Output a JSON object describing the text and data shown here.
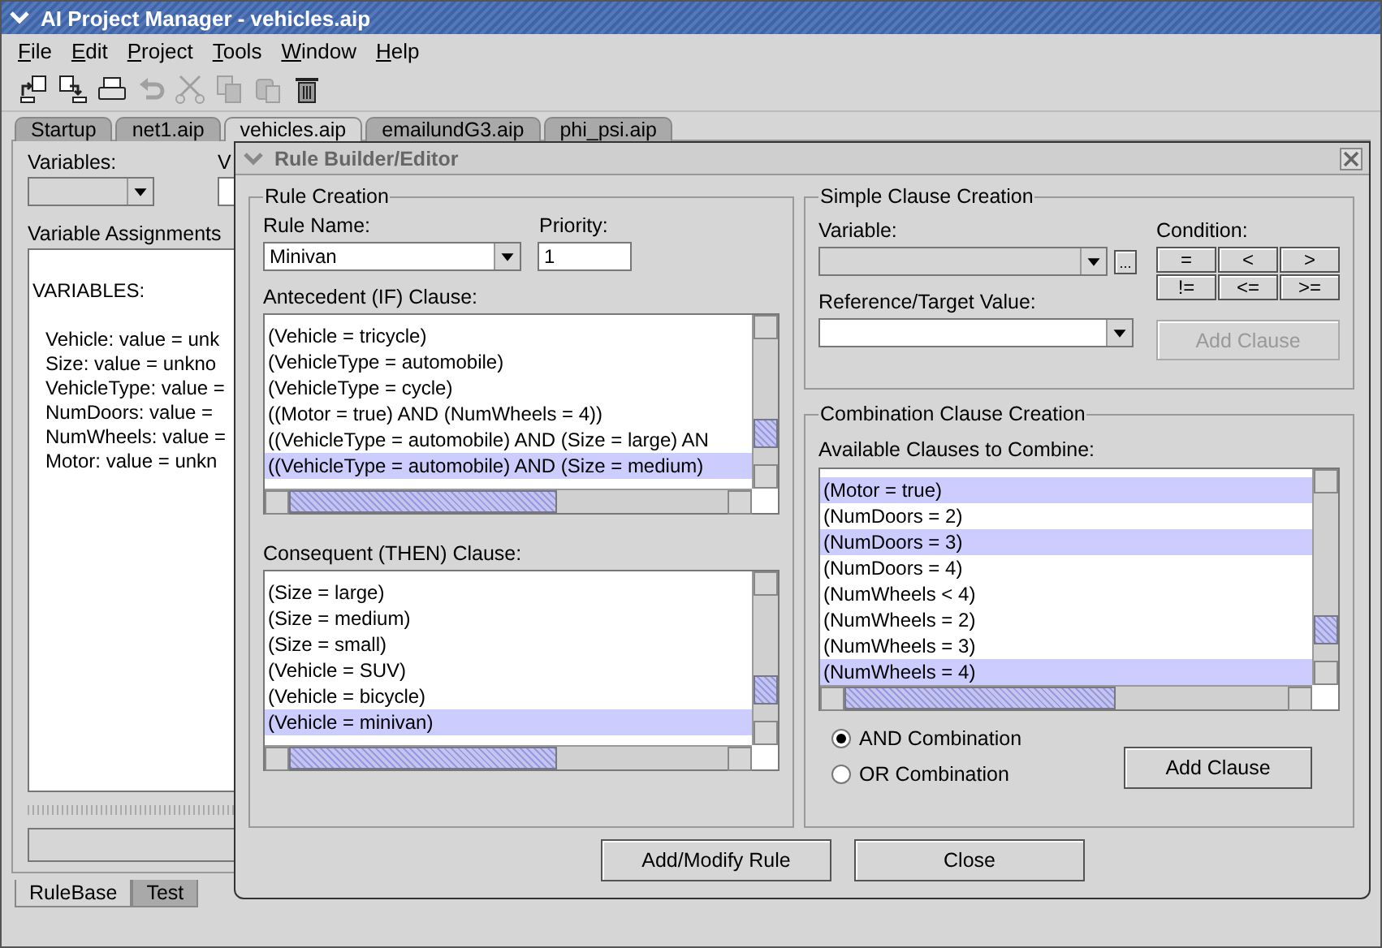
{
  "window": {
    "title": "AI Project Manager - vehicles.aip"
  },
  "menu": [
    "File",
    "Edit",
    "Project",
    "Tools",
    "Window",
    "Help"
  ],
  "toolbar": [
    {
      "kind": "open",
      "disabled": false
    },
    {
      "kind": "save",
      "disabled": false
    },
    {
      "kind": "print",
      "disabled": false
    },
    {
      "kind": "undo",
      "disabled": true
    },
    {
      "kind": "cut",
      "disabled": true
    },
    {
      "kind": "copy",
      "disabled": true
    },
    {
      "kind": "paste",
      "disabled": true
    },
    {
      "kind": "delete",
      "disabled": false
    }
  ],
  "tabs": [
    {
      "label": "Startup",
      "selected": false
    },
    {
      "label": "net1.aip",
      "selected": false
    },
    {
      "label": "vehicles.aip",
      "selected": true
    },
    {
      "label": "emailundG3.aip",
      "selected": false
    },
    {
      "label": "phi_psi.aip",
      "selected": false
    }
  ],
  "main_panel": {
    "variables_label": "Variables:",
    "value_label": "V",
    "assignments_label": "Variable Assignments",
    "assignments_heading": "VARIABLES:",
    "assignments_lines": [
      "Vehicle: value = unk",
      "Size: value = unkno",
      "VehicleType: value =",
      "NumDoors: value =",
      "NumWheels: value =",
      "Motor: value = unkn"
    ]
  },
  "bottom_tabs": [
    {
      "label": "RuleBase",
      "selected": true
    },
    {
      "label": "Test",
      "selected": false
    }
  ],
  "dialog": {
    "title": "Rule Builder/Editor",
    "rule_creation": {
      "legend": "Rule Creation",
      "rule_name_label": "Rule Name:",
      "rule_name": "Minivan",
      "priority_label": "Priority:",
      "priority": "1",
      "antecedent_label": "Antecedent (IF) Clause:",
      "antecedent_items": [
        {
          "text": "(Vehicle = tricycle)",
          "selected": false
        },
        {
          "text": "(VehicleType = automobile)",
          "selected": false
        },
        {
          "text": "(VehicleType = cycle)",
          "selected": false
        },
        {
          "text": "((Motor = true) AND (NumWheels = 4))",
          "selected": false
        },
        {
          "text": "((VehicleType = automobile) AND (Size = large) AN",
          "selected": false
        },
        {
          "text": "((VehicleType = automobile) AND (Size = medium)",
          "selected": true
        }
      ],
      "consequent_label": "Consequent (THEN) Clause:",
      "consequent_items": [
        {
          "text": "(Size = large)",
          "selected": false
        },
        {
          "text": "(Size = medium)",
          "selected": false
        },
        {
          "text": "(Size = small)",
          "selected": false
        },
        {
          "text": "(Vehicle = SUV)",
          "selected": false
        },
        {
          "text": "(Vehicle = bicycle)",
          "selected": false
        },
        {
          "text": "(Vehicle = minivan)",
          "selected": true
        }
      ]
    },
    "simple_clause": {
      "legend": "Simple Clause Creation",
      "variable_label": "Variable:",
      "more_button": "...",
      "condition_label": "Condition:",
      "conditions": [
        "=",
        "<",
        ">",
        "!=",
        "<=",
        ">="
      ],
      "target_label": "Reference/Target Value:",
      "add_button": {
        "label": "Add Clause",
        "disabled": true
      }
    },
    "combination": {
      "legend": "Combination Clause Creation",
      "available_label": "Available Clauses to Combine:",
      "items": [
        {
          "text": "(Motor = true)",
          "selected": true
        },
        {
          "text": "(NumDoors = 2)",
          "selected": false
        },
        {
          "text": "(NumDoors = 3)",
          "selected": true
        },
        {
          "text": "(NumDoors = 4)",
          "selected": false
        },
        {
          "text": "(NumWheels < 4)",
          "selected": false
        },
        {
          "text": "(NumWheels = 2)",
          "selected": false
        },
        {
          "text": "(NumWheels = 3)",
          "selected": false
        },
        {
          "text": "(NumWheels = 4)",
          "selected": true
        }
      ],
      "options": [
        {
          "label": "AND Combination",
          "selected": true
        },
        {
          "label": "OR Combination",
          "selected": false
        }
      ],
      "add_button": {
        "label": "Add Clause",
        "disabled": false
      }
    },
    "buttons": [
      "Add/Modify Rule",
      "Close"
    ]
  }
}
